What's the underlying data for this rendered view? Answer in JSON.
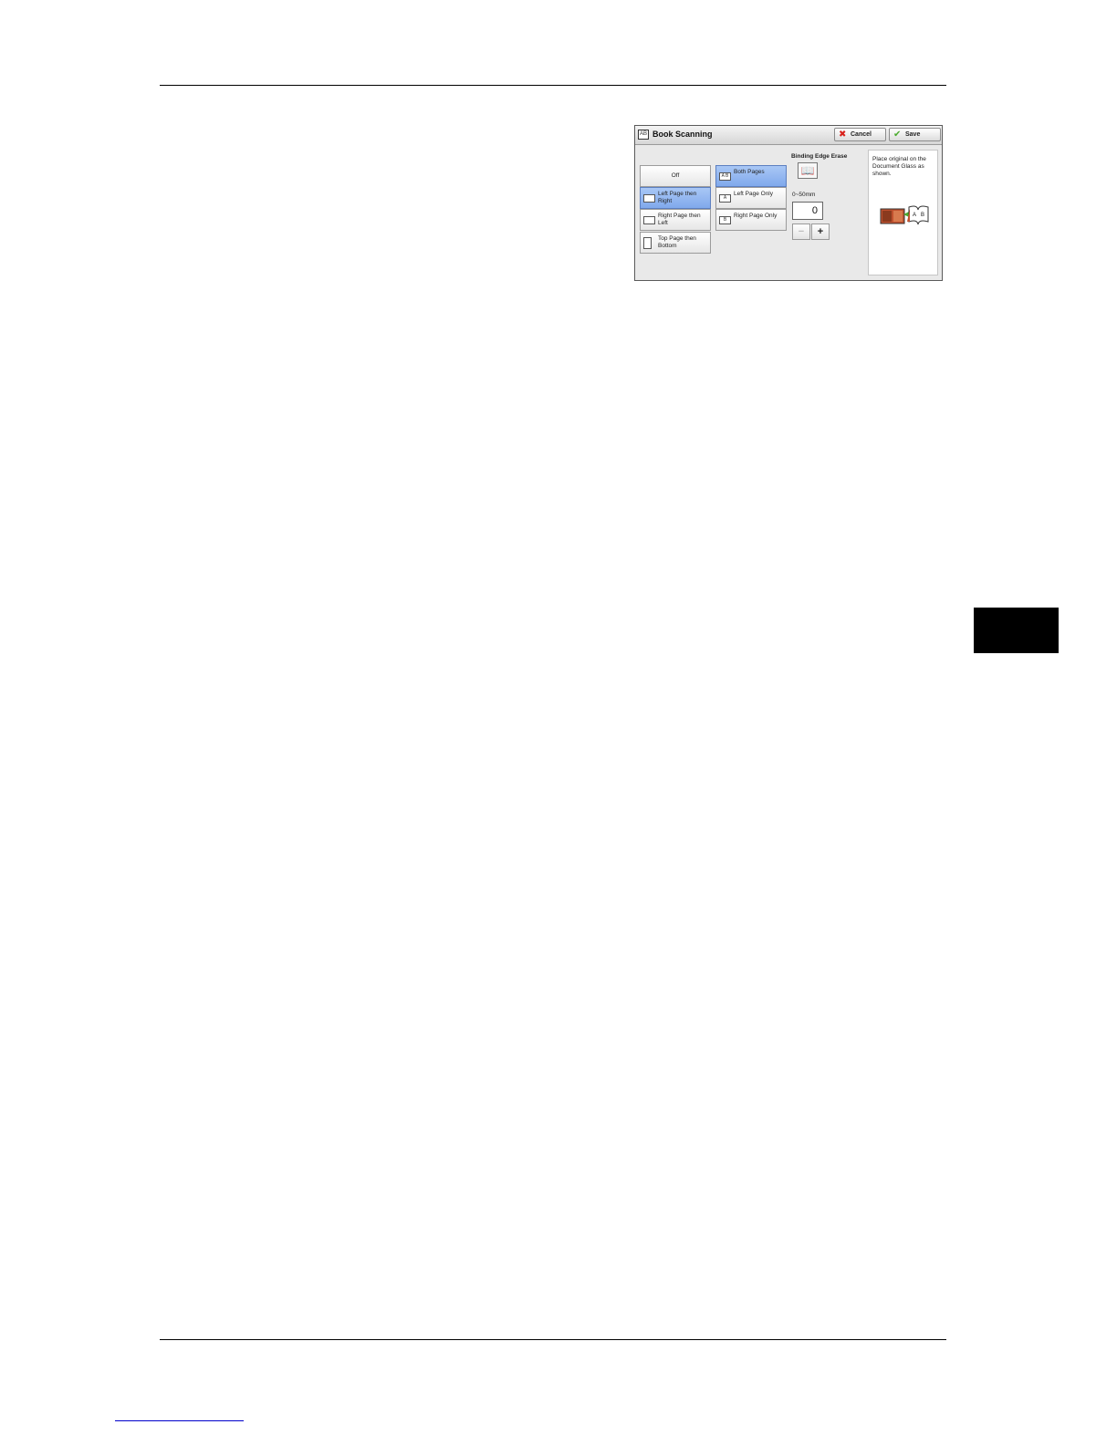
{
  "panel": {
    "title": "Book Scanning",
    "title_icon": "AB",
    "cancel_label": "Cancel",
    "save_label": "Save"
  },
  "scan_order": {
    "options": [
      {
        "label": "Off",
        "selected": false
      },
      {
        "label": "Left Page then Right",
        "selected": true
      },
      {
        "label": "Right Page then Left",
        "selected": false
      },
      {
        "label": "Top Page then Bottom",
        "selected": false
      }
    ]
  },
  "pages": {
    "options": [
      {
        "label": "Both Pages",
        "icon_text": "A B",
        "selected": true
      },
      {
        "label": "Left Page Only",
        "icon_text": "A",
        "selected": false
      },
      {
        "label": "Right Page Only",
        "icon_text": "B",
        "selected": false
      }
    ]
  },
  "binding_edge": {
    "label": "Binding Edge Erase",
    "range": "0~50mm",
    "value": "0",
    "minus": "−",
    "plus": "+"
  },
  "guide": {
    "text": "Place original on the Document Glass as shown."
  },
  "colors": {
    "selected": "#80a9ec",
    "cancel_icon": "#d8201a",
    "save_icon": "#4cab2f"
  },
  "icons": [
    "book-scanning-icon",
    "cancel-x-icon",
    "save-check-icon",
    "open-book-icon",
    "document-glass-illustration"
  ]
}
